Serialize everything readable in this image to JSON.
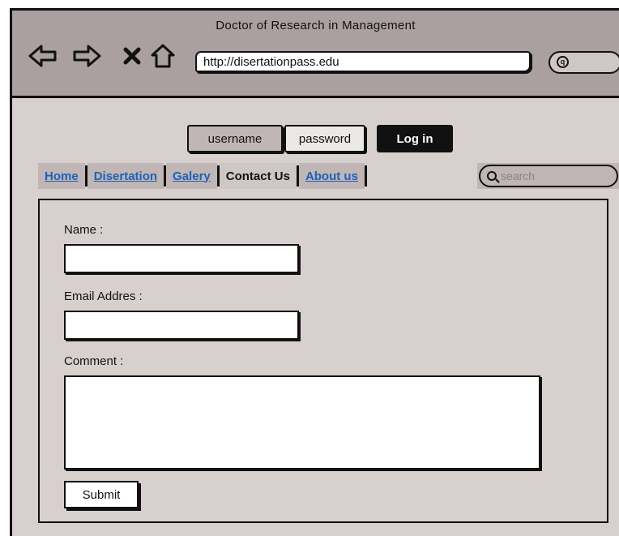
{
  "window": {
    "title": "Doctor of Research in Management",
    "url": "http://disertationpass.edu"
  },
  "toolbar": {
    "back_icon": "back-arrow-icon",
    "forward_icon": "forward-arrow-icon",
    "stop_icon": "close-icon",
    "home_icon": "home-icon"
  },
  "login": {
    "username_placeholder": "username",
    "password_placeholder": "password",
    "button_label": "Log in"
  },
  "nav": {
    "tabs": [
      {
        "label": "Home",
        "active": false
      },
      {
        "label": "Disertation",
        "active": false
      },
      {
        "label": "Galery",
        "active": false
      },
      {
        "label": "Contact Us",
        "active": true
      },
      {
        "label": "About us",
        "active": false
      }
    ],
    "search_placeholder": "search"
  },
  "form": {
    "name_label": "Name :",
    "email_label": "Email Addres :",
    "comment_label": "Comment :",
    "submit_label": "Submit"
  },
  "colors": {
    "window_bg": "#d8d0cf",
    "titlebar_bg": "#a9a09f",
    "link": "#2060b8"
  }
}
